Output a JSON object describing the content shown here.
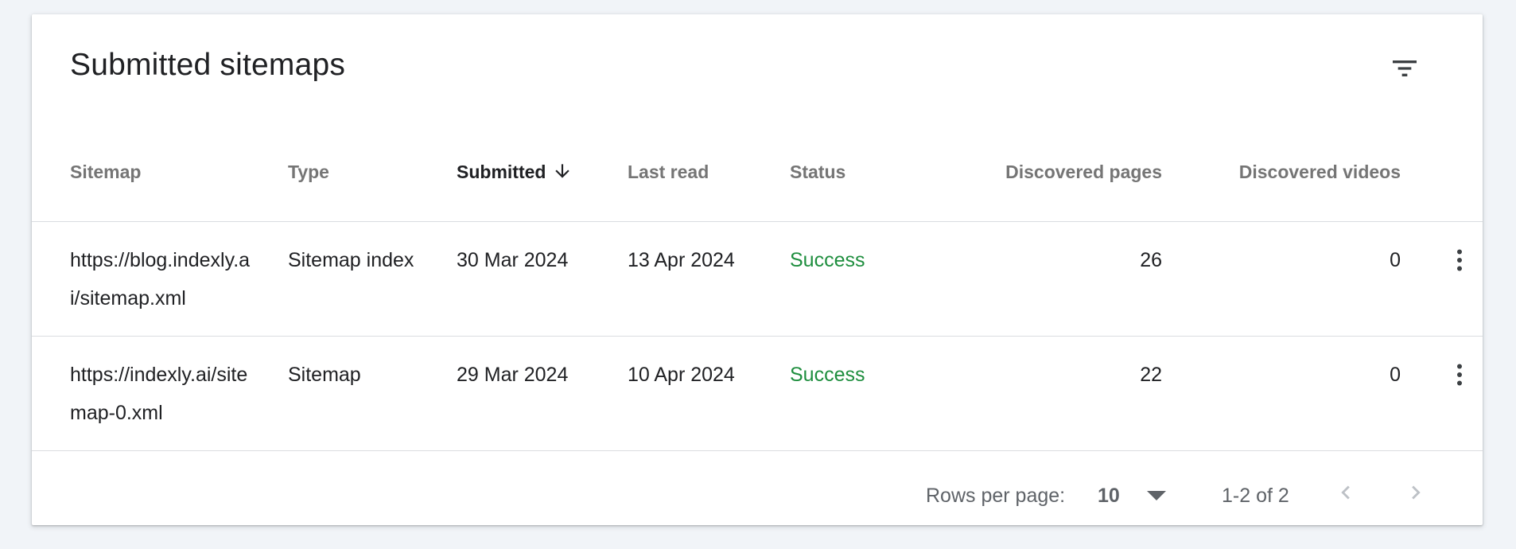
{
  "card": {
    "title": "Submitted sitemaps",
    "filter_icon": "filter-list-icon"
  },
  "table": {
    "columns": [
      {
        "key": "sitemap",
        "label": "Sitemap"
      },
      {
        "key": "type",
        "label": "Type"
      },
      {
        "key": "submitted",
        "label": "Submitted",
        "sorted": "descending"
      },
      {
        "key": "last_read",
        "label": "Last read"
      },
      {
        "key": "status",
        "label": "Status"
      },
      {
        "key": "discovered_pages",
        "label": "Discovered pages"
      },
      {
        "key": "discovered_videos",
        "label": "Discovered videos"
      }
    ],
    "rows": [
      {
        "sitemap": "https://blog.indexly.ai/sitemap.xml",
        "type": "Sitemap index",
        "submitted": "30 Mar 2024",
        "last_read": "13 Apr 2024",
        "status": "Success",
        "discovered_pages": "26",
        "discovered_videos": "0"
      },
      {
        "sitemap": "https://indexly.ai/sitemap-0.xml",
        "type": "Sitemap",
        "submitted": "29 Mar 2024",
        "last_read": "10 Apr 2024",
        "status": "Success",
        "discovered_pages": "22",
        "discovered_videos": "0"
      }
    ]
  },
  "footer": {
    "rows_per_page_label": "Rows per page:",
    "rows_per_page_value": "10",
    "page_range": "1-2 of 2"
  },
  "colors": {
    "success": "#1e8e3e",
    "header_text": "#757575",
    "body_text": "#202124",
    "background": "#f1f4f8"
  }
}
